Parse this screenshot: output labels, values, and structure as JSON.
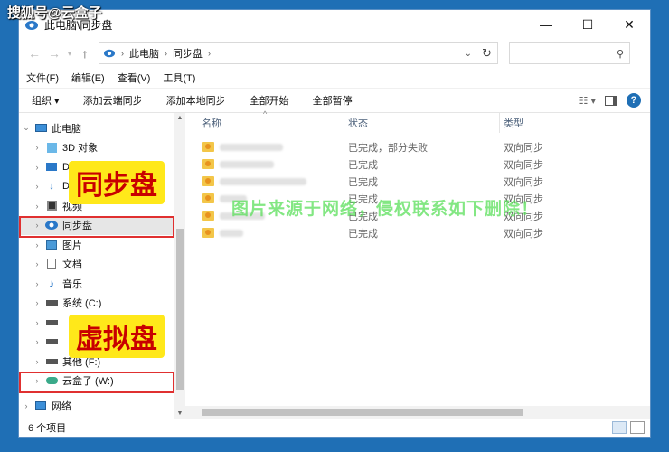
{
  "watermark_top": "搜狐号@云盒子",
  "watermark_mid": "图片来源于网络，侵权联系如下删除！",
  "window": {
    "title": "此电脑\\同步盘"
  },
  "address": {
    "crumbs": [
      "此电脑",
      "同步盘"
    ]
  },
  "menu": [
    "文件(F)",
    "编辑(E)",
    "查看(V)",
    "工具(T)"
  ],
  "toolbar": [
    "组织 ▾",
    "添加云端同步",
    "添加本地同步",
    "全部开始",
    "全部暂停"
  ],
  "nav": {
    "items": [
      {
        "label": "此电脑",
        "icon": "pc-icon"
      },
      {
        "label": "3D 对象",
        "icon": "cube-icon"
      },
      {
        "label": "D",
        "icon": "folder-icon"
      },
      {
        "label": "D",
        "icon": "download-icon"
      },
      {
        "label": "视频",
        "icon": "video-icon"
      },
      {
        "label": "同步盘",
        "icon": "cloud-sync-icon"
      },
      {
        "label": "图片",
        "icon": "picture-icon"
      },
      {
        "label": "文档",
        "icon": "document-icon"
      },
      {
        "label": "音乐",
        "icon": "music-icon"
      },
      {
        "label": "系统 (C:)",
        "icon": "drive-icon"
      },
      {
        "label": "",
        "icon": "drive-icon"
      },
      {
        "label": "",
        "icon": "drive-icon"
      },
      {
        "label": "其他 (F:)",
        "icon": "drive-icon"
      },
      {
        "label": "云盒子 (W:)",
        "icon": "cloud-drive-icon"
      },
      {
        "label": "网络",
        "icon": "network-icon"
      }
    ]
  },
  "columns": {
    "name": "名称",
    "status": "状态",
    "type": "类型"
  },
  "rows": [
    {
      "status": "已完成，部分失败",
      "type": "双向同步"
    },
    {
      "status": "已完成",
      "type": "双向同步"
    },
    {
      "status": "已完成",
      "type": "双向同步"
    },
    {
      "status": "已完成",
      "type": "双向同步"
    },
    {
      "status": "已完成",
      "type": "双向同步"
    },
    {
      "status": "已完成",
      "type": "双向同步"
    }
  ],
  "statusbar": {
    "count": "6 个项目"
  },
  "callouts": {
    "sync": "同步盘",
    "virtual": "虚拟盘"
  }
}
